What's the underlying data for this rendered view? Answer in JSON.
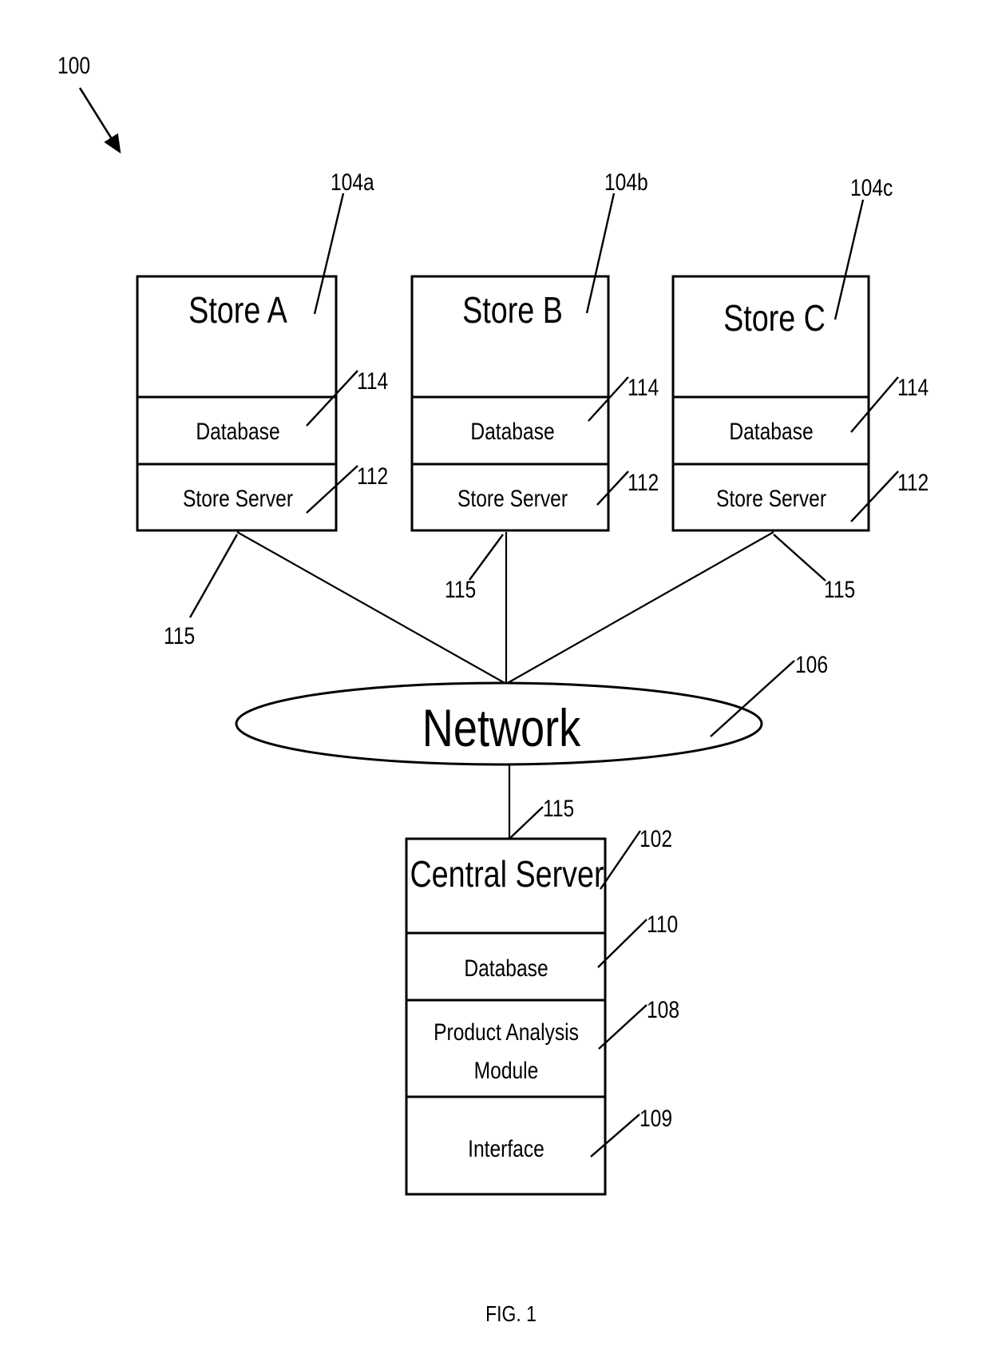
{
  "figure": {
    "system_ref": "100",
    "caption": "FIG. 1"
  },
  "stores": [
    {
      "title": "Store A",
      "ref": "104a",
      "database_label": "Database",
      "database_ref": "114",
      "server_label": "Store Server",
      "server_ref": "112",
      "link_ref": "115"
    },
    {
      "title": "Store B",
      "ref": "104b",
      "database_label": "Database",
      "database_ref": "114",
      "server_label": "Store Server",
      "server_ref": "112",
      "link_ref": "115"
    },
    {
      "title": "Store C",
      "ref": "104c",
      "database_label": "Database",
      "database_ref": "114",
      "server_label": "Store Server",
      "server_ref": "112",
      "link_ref": "115"
    }
  ],
  "network": {
    "label": "Network",
    "ref": "106"
  },
  "central_server": {
    "title": "Central Server",
    "ref": "102",
    "link_ref": "115",
    "database_label": "Database",
    "database_ref": "110",
    "module_label_line1": "Product Analysis",
    "module_label_line2": "Module",
    "module_ref": "108",
    "interface_label": "Interface",
    "interface_ref": "109"
  }
}
